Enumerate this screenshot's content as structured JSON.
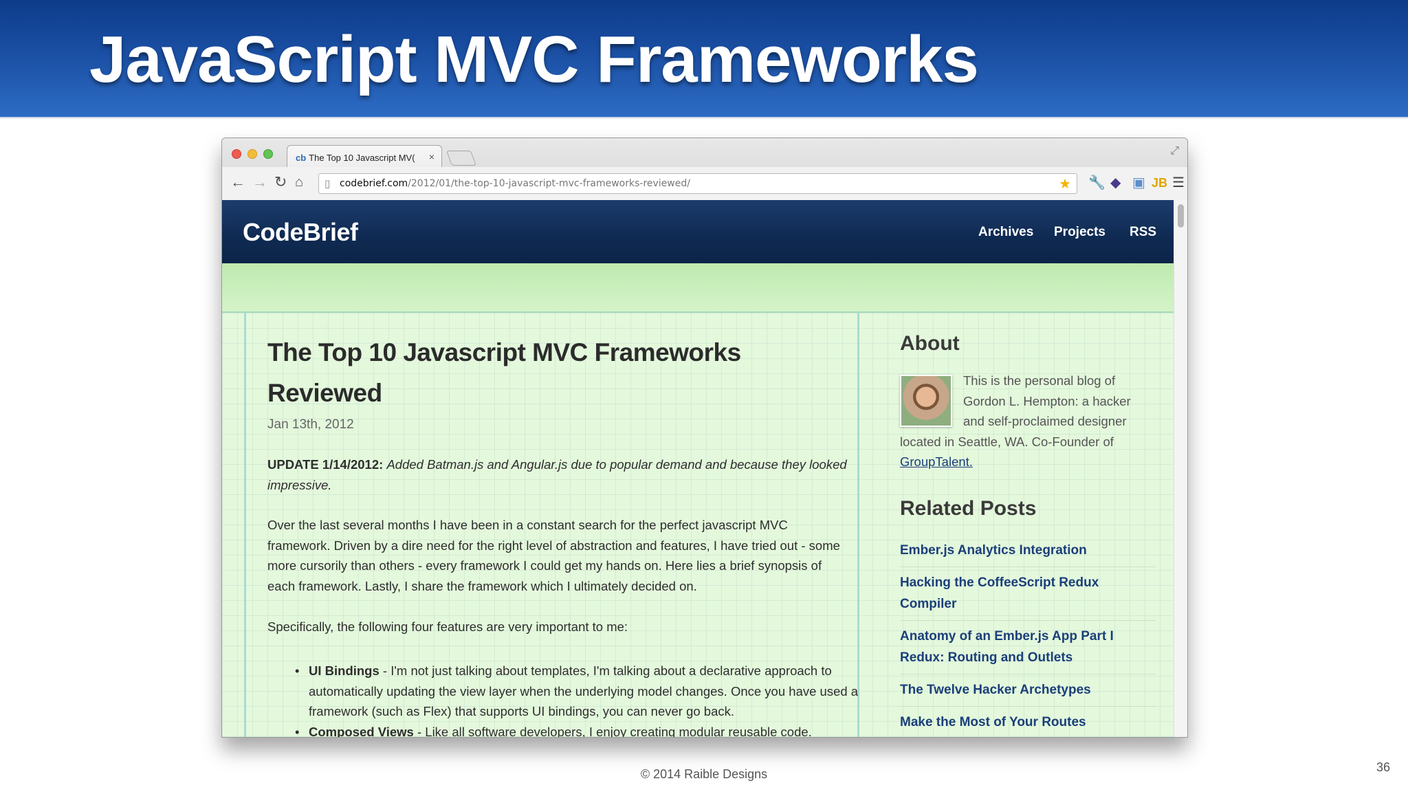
{
  "slide": {
    "title": "JavaScript MVC Frameworks",
    "copyright": "© 2014 Raible Designs",
    "page_number": "36"
  },
  "browser": {
    "tab": {
      "favicon": "cb",
      "title": "The Top 10 Javascript MV(",
      "close": "×"
    },
    "url": {
      "host": "codebrief.com",
      "path": "/2012/01/the-top-10-javascript-mvc-frameworks-reviewed/"
    },
    "icons": [
      "back-arrow-icon",
      "forward-arrow-icon",
      "reload-icon",
      "home-icon",
      "star-icon",
      "wrench-icon",
      "extension-icons"
    ]
  },
  "site": {
    "logo": "CodeBrief",
    "nav": [
      "Archives",
      "Projects",
      "RSS"
    ]
  },
  "post": {
    "title": "The Top 10 Javascript MVC Frameworks Reviewed",
    "date": "Jan 13th, 2012",
    "update_label": "UPDATE 1/14/2012:",
    "update_text": "Added Batman.js and Angular.js due to popular demand and because they looked impressive.",
    "intro": "Over the last several months I have been in a constant search for the perfect javascript MVC framework. Driven by a dire need for the right level of abstraction and features, I have tried out - some more cursorily than others - every framework I could get my hands on. Here lies a brief synopsis of each framework. Lastly, I share the framework which I ultimately decided on.",
    "features_intro": "Specifically, the following four features are very important to me:",
    "bullets": [
      {
        "term": "UI Bindings",
        "text": " - I'm not just talking about templates, I'm talking about a declarative approach to automatically updating the view layer when the underlying model changes. Once you have used a framework (such as Flex) that supports UI bindings, you can never go back."
      },
      {
        "term": "Composed Views",
        "text": " - Like all software developers, I enjoy creating modular reusable code."
      }
    ]
  },
  "sidebar": {
    "about_heading": "About",
    "about_text_1": "This is the personal blog of",
    "about_text_2": "Gordon L. Hempton: a hacker",
    "about_text_3": "and self-proclaimed designer",
    "about_text_4": "located in Seattle, WA. Co-Founder of",
    "about_link": "GroupTalent.",
    "related_heading": "Related Posts",
    "related": [
      "Ember.js Analytics Integration",
      "Hacking the CoffeeScript Redux Compiler",
      "Anatomy of an Ember.js App Part I Redux: Routing and Outlets",
      "The Twelve Hacker Archetypes",
      "Make the Most of Your Routes"
    ]
  }
}
